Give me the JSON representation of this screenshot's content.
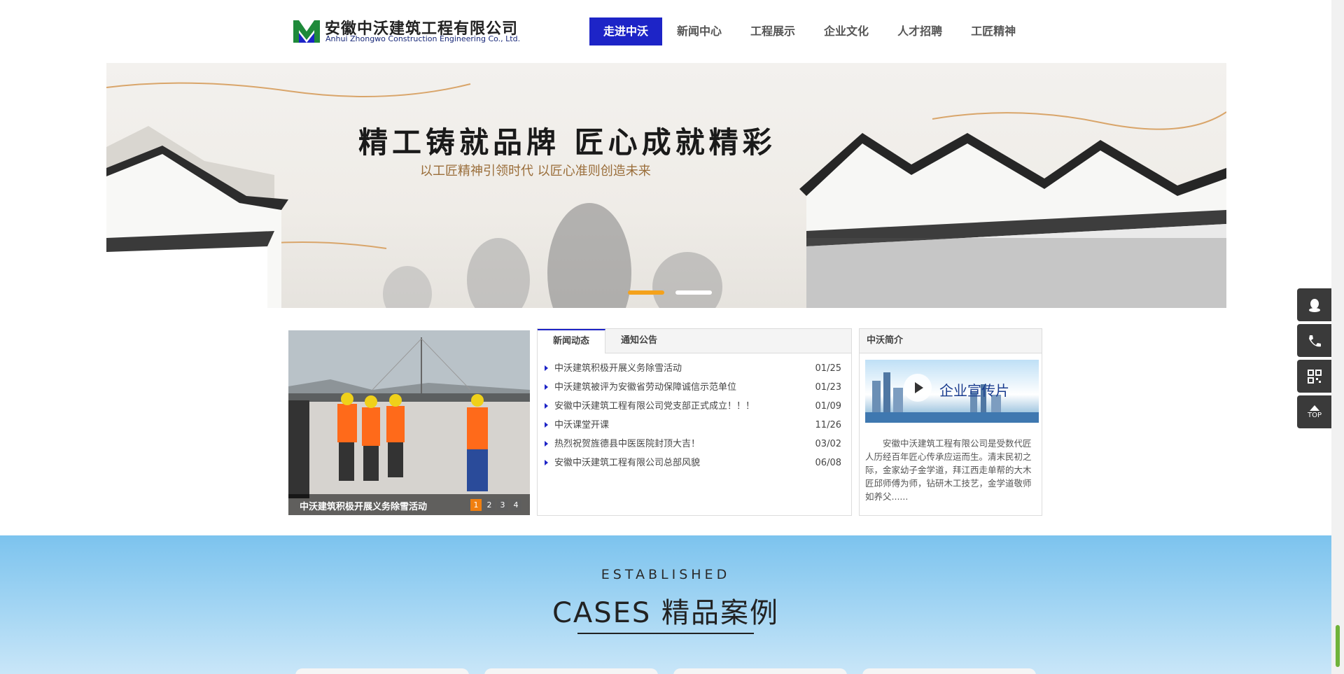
{
  "logo": {
    "cn": "安徽中沃建筑工程有限公司",
    "en": "Anhui Zhongwo Construction Engineering Co., Ltd."
  },
  "nav": [
    {
      "label": "走进中沃",
      "active": true
    },
    {
      "label": "新闻中心",
      "active": false
    },
    {
      "label": "工程展示",
      "active": false
    },
    {
      "label": "企业文化",
      "active": false
    },
    {
      "label": "人才招聘",
      "active": false
    },
    {
      "label": "工匠精神",
      "active": false
    }
  ],
  "banner": {
    "title": "精工铸就品牌  匠心成就精彩",
    "subtitle": "以工匠精神引领时代   以匠心准则创造未来"
  },
  "photo": {
    "caption": "中沃建筑积极开展义务除雪活动",
    "pages": [
      "1",
      "2",
      "3",
      "4"
    ]
  },
  "news": {
    "tabs": [
      "新闻动态",
      "通知公告"
    ],
    "items": [
      {
        "title": "中沃建筑积极开展义务除雪活动",
        "date": "01/25"
      },
      {
        "title": "中沃建筑被评为安徽省劳动保障诚信示范单位",
        "date": "01/23"
      },
      {
        "title": "安徽中沃建筑工程有限公司党支部正式成立！！！",
        "date": "01/09"
      },
      {
        "title": "中沃课堂开课",
        "date": "11/26"
      },
      {
        "title": "热烈祝贺旌德县中医医院封顶大吉！",
        "date": "03/02"
      },
      {
        "title": "安徽中沃建筑工程有限公司总部风貌",
        "date": "06/08"
      }
    ]
  },
  "intro": {
    "heading": "中沃简介",
    "video_label": "企业宣传片",
    "text": "安徽中沃建筑工程有限公司是受数代匠人历经百年匠心传承应运而生。清末民初之际，金家幼子金学道，拜江西走单帮的大木匠邱师傅为师，钻研木工技艺，金学道敬师如养父......"
  },
  "float": {
    "top_label": "TOP"
  },
  "cases": {
    "subtitle": "ESTABLISHED",
    "title": "CASES 精品案例"
  },
  "colors": {
    "accent": "#1d24c7",
    "orange": "#f07f10"
  }
}
